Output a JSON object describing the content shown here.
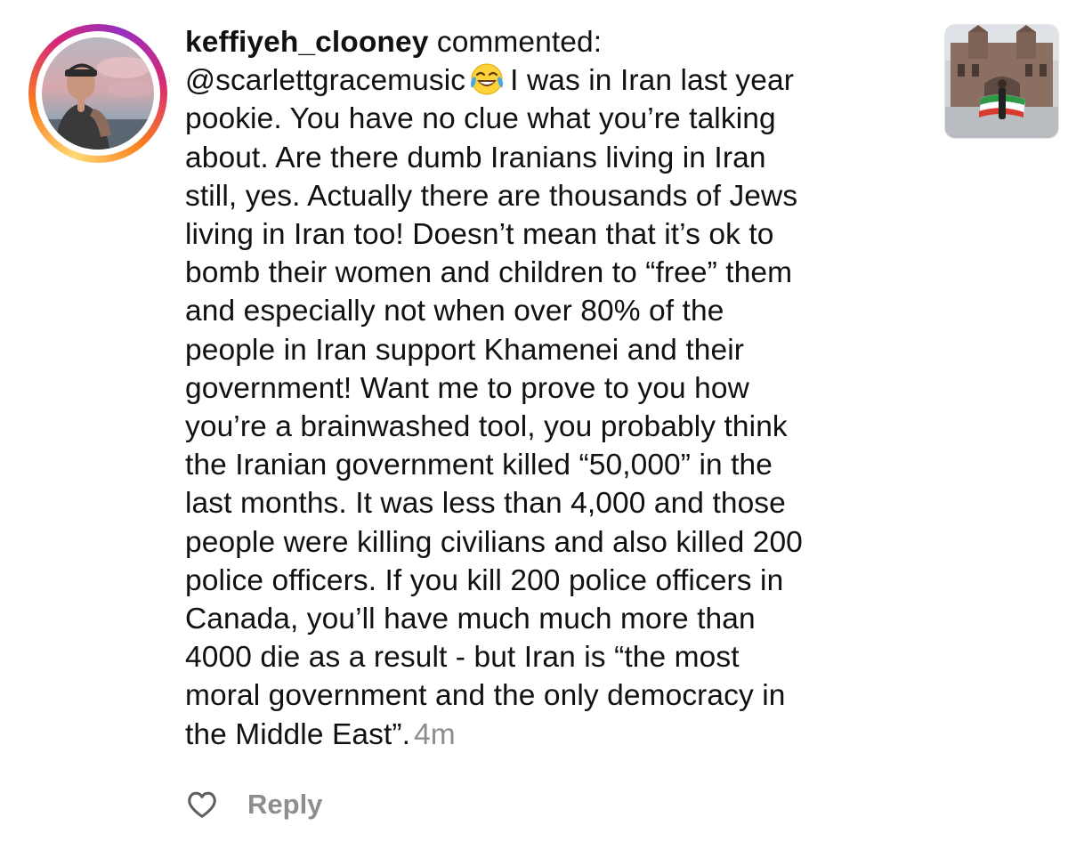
{
  "comment": {
    "username": "keffiyeh_clooney",
    "action": " commented:",
    "mention": "@scarlettgracemusic",
    "emoji": "face-with-tears-of-joy",
    "lines": [
      "I was in Iran last year",
      "pookie. You have no clue what you’re talking",
      "about. Are there dumb Iranians living in Iran",
      "still, yes. Actually there are thousands of Jews",
      "living in Iran too! Doesn’t mean that it’s ok to",
      "bomb their women and children to “free” them",
      "and especially not when over 80% of the",
      "people in Iran support Khamenei and their",
      "government! Want me to prove to you how",
      "you’re a brainwashed tool, you probably think",
      "the Iranian government killed “50,000” in the",
      "last months. It was less than 4,000 and those",
      "people were killing civilians and also killed 200",
      "police officers. If you kill 200 police officers in",
      "Canada, you’ll have much much more than",
      "4000 die as a result - but Iran is “the most",
      "moral government and the only democracy in",
      "the Middle East”."
    ],
    "timestamp": "4m"
  },
  "actions": {
    "like_icon": "heart-outline-icon",
    "reply_label": "Reply"
  },
  "colors": {
    "text": "#111111",
    "muted": "#8e8e8e",
    "story_ring": [
      "#feda75",
      "#fa7e1e",
      "#d62976",
      "#962fbf"
    ]
  }
}
